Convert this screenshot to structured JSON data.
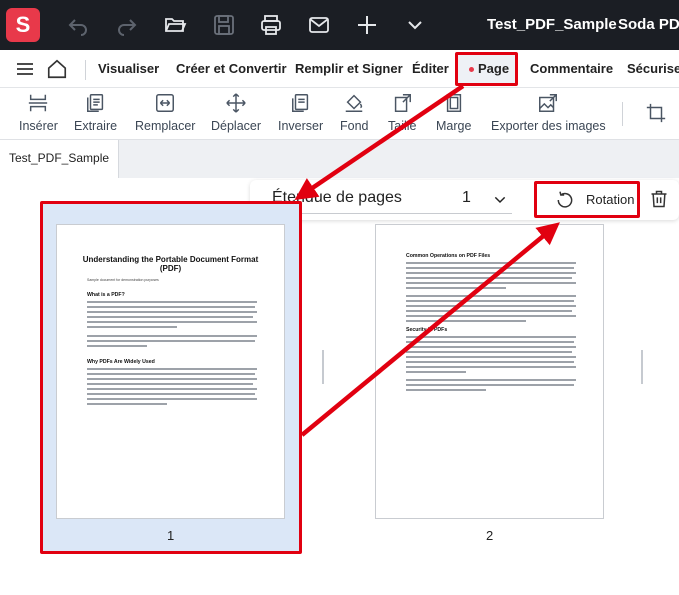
{
  "app": {
    "logo_letter": "S",
    "doc_title": "Test_PDF_Sample",
    "name": "Soda PDF"
  },
  "menu": {
    "items": [
      "Visualiser",
      "Créer et Convertir",
      "Remplir et Signer",
      "Éditer",
      "Page",
      "Commentaire",
      "Sécuriser"
    ]
  },
  "toolbar": {
    "items": [
      "Insérer",
      "Extraire",
      "Remplacer",
      "Déplacer",
      "Inverser",
      "Fond",
      "Taille",
      "Marge",
      "Exporter des images"
    ]
  },
  "file_tab": "Test_PDF_Sample",
  "page_range": {
    "label": "Étendue de pages",
    "value": "1",
    "rotate_label": "Rotation"
  },
  "pages": [
    {
      "number": "1",
      "title": "Understanding the Portable Document Format (PDF)",
      "subtitle": "Sample document for demonstration purposes",
      "headings": [
        "What is a PDF?",
        "Why PDFs Are Widely Used"
      ]
    },
    {
      "number": "2",
      "headings": [
        "Common Operations on PDF Files",
        "Security in PDFs"
      ]
    }
  ],
  "colors": {
    "accent": "#e8394a",
    "highlight": "#e10010",
    "selection": "#dbe7f7",
    "titlebar": "#1b1e24"
  }
}
